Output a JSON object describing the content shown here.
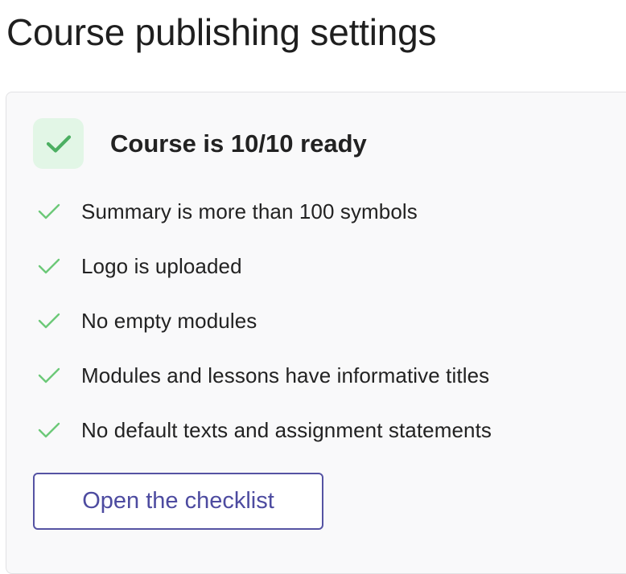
{
  "page": {
    "title": "Course publishing settings"
  },
  "readiness": {
    "title": "Course is 10/10 ready",
    "icon": "check-icon",
    "icon_color": "#4caf62",
    "icon_bg": "#e2f6e6"
  },
  "checklist": {
    "item_icon": "check-icon",
    "item_icon_color": "#6cc978",
    "items": [
      {
        "label": "Summary is more than 100 symbols"
      },
      {
        "label": "Logo is uploaded"
      },
      {
        "label": "No empty modules"
      },
      {
        "label": "Modules and lessons have informative titles"
      },
      {
        "label": "No default texts and assignment statements"
      }
    ]
  },
  "actions": {
    "open_checklist_label": "Open the checklist",
    "accent_color": "#5553a3"
  }
}
